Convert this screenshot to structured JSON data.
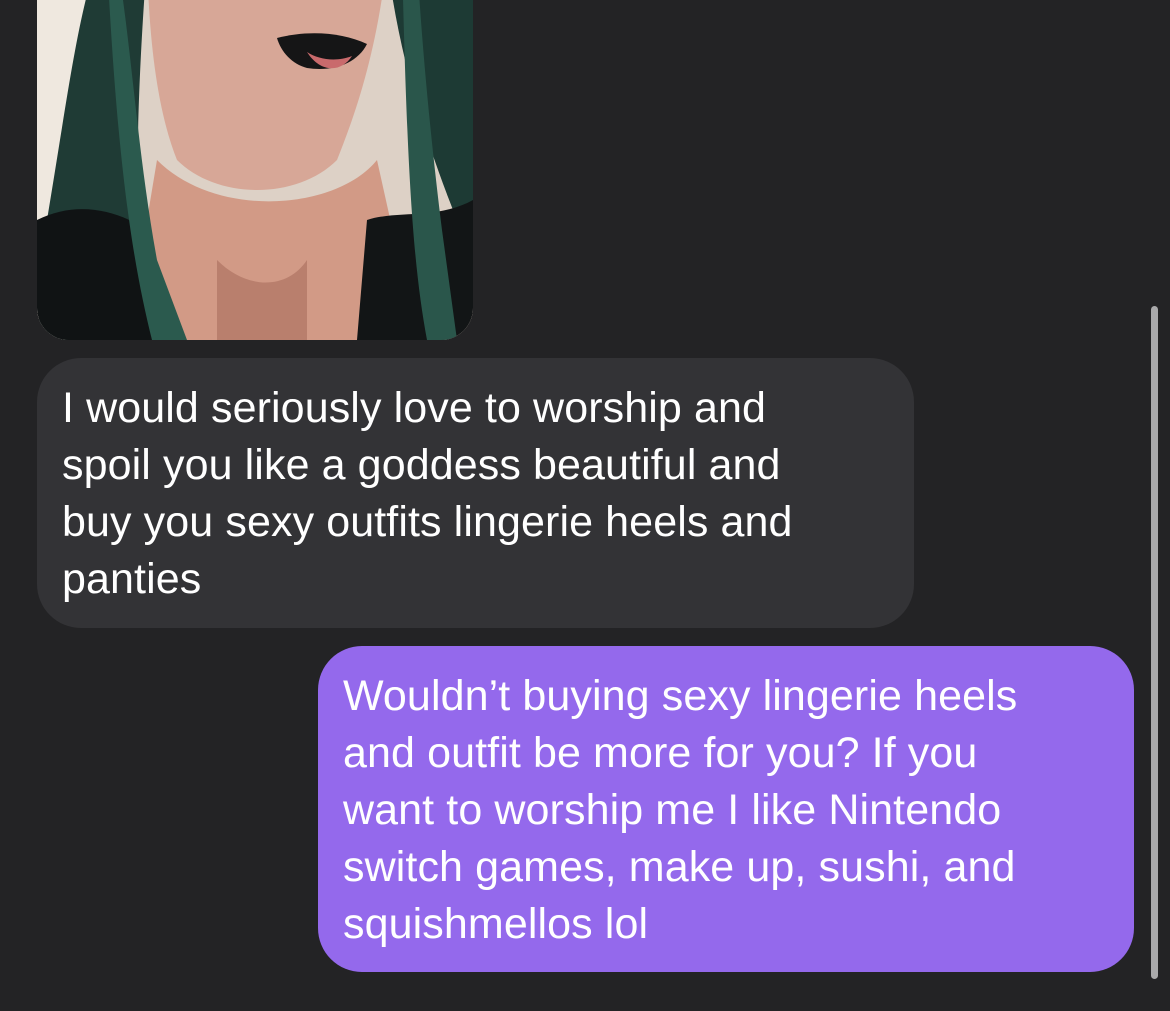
{
  "conversation": {
    "photo": {
      "description_icon": "photo-attachment",
      "alt": ""
    },
    "incoming_message": {
      "lines": [
        "I would seriously love to worship and",
        "spoil you like a goddess beautiful and",
        "buy you sexy outfits lingerie heels and",
        "panties"
      ]
    },
    "outgoing_message": {
      "lines": [
        "Wouldn’t buying sexy lingerie heels",
        "and outfit be more for you? If you",
        "want to worship me I like Nintendo",
        "switch games, make up, sushi, and",
        "squishmellos lol"
      ]
    }
  },
  "colors": {
    "background": "#232325",
    "incoming_bubble": "#333336",
    "outgoing_bubble": "#9469ec",
    "text": "#ffffff",
    "scrollbar": "#a9a9ab"
  }
}
